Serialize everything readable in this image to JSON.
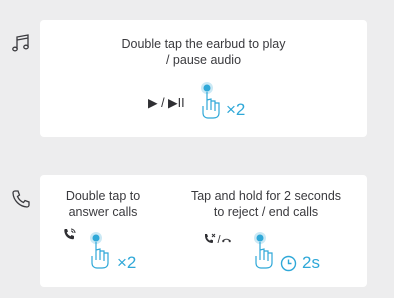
{
  "audio": {
    "icon": "music-note-icon",
    "instruction_line1": "Double tap the earbud to play",
    "instruction_line2": "/ pause audio",
    "control_symbol": "▶ / ▶II",
    "tap_count": "×2"
  },
  "calls": {
    "icon": "phone-icon",
    "answer": {
      "line1": "Double tap to",
      "line2": "answer calls",
      "tap_count": "×2"
    },
    "reject": {
      "line1": "Tap and hold for 2 seconds",
      "line2": "to reject / end calls",
      "hold_duration": "2s"
    }
  },
  "colors": {
    "accent": "#2fa8d8",
    "card": "#ffffff",
    "background": "#ededee",
    "text": "#3a3a3e"
  }
}
